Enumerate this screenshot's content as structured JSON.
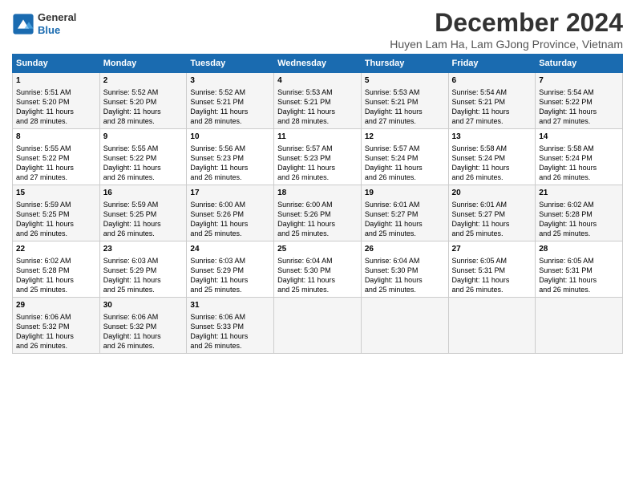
{
  "logo": {
    "general": "General",
    "blue": "Blue"
  },
  "title": "December 2024",
  "subtitle": "Huyen Lam Ha, Lam GJong Province, Vietnam",
  "days_of_week": [
    "Sunday",
    "Monday",
    "Tuesday",
    "Wednesday",
    "Thursday",
    "Friday",
    "Saturday"
  ],
  "weeks": [
    [
      {
        "day": "1",
        "info": "Sunrise: 5:51 AM\nSunset: 5:20 PM\nDaylight: 11 hours\nand 28 minutes."
      },
      {
        "day": "2",
        "info": "Sunrise: 5:52 AM\nSunset: 5:20 PM\nDaylight: 11 hours\nand 28 minutes."
      },
      {
        "day": "3",
        "info": "Sunrise: 5:52 AM\nSunset: 5:21 PM\nDaylight: 11 hours\nand 28 minutes."
      },
      {
        "day": "4",
        "info": "Sunrise: 5:53 AM\nSunset: 5:21 PM\nDaylight: 11 hours\nand 28 minutes."
      },
      {
        "day": "5",
        "info": "Sunrise: 5:53 AM\nSunset: 5:21 PM\nDaylight: 11 hours\nand 27 minutes."
      },
      {
        "day": "6",
        "info": "Sunrise: 5:54 AM\nSunset: 5:21 PM\nDaylight: 11 hours\nand 27 minutes."
      },
      {
        "day": "7",
        "info": "Sunrise: 5:54 AM\nSunset: 5:22 PM\nDaylight: 11 hours\nand 27 minutes."
      }
    ],
    [
      {
        "day": "8",
        "info": "Sunrise: 5:55 AM\nSunset: 5:22 PM\nDaylight: 11 hours\nand 27 minutes."
      },
      {
        "day": "9",
        "info": "Sunrise: 5:55 AM\nSunset: 5:22 PM\nDaylight: 11 hours\nand 26 minutes."
      },
      {
        "day": "10",
        "info": "Sunrise: 5:56 AM\nSunset: 5:23 PM\nDaylight: 11 hours\nand 26 minutes."
      },
      {
        "day": "11",
        "info": "Sunrise: 5:57 AM\nSunset: 5:23 PM\nDaylight: 11 hours\nand 26 minutes."
      },
      {
        "day": "12",
        "info": "Sunrise: 5:57 AM\nSunset: 5:24 PM\nDaylight: 11 hours\nand 26 minutes."
      },
      {
        "day": "13",
        "info": "Sunrise: 5:58 AM\nSunset: 5:24 PM\nDaylight: 11 hours\nand 26 minutes."
      },
      {
        "day": "14",
        "info": "Sunrise: 5:58 AM\nSunset: 5:24 PM\nDaylight: 11 hours\nand 26 minutes."
      }
    ],
    [
      {
        "day": "15",
        "info": "Sunrise: 5:59 AM\nSunset: 5:25 PM\nDaylight: 11 hours\nand 26 minutes."
      },
      {
        "day": "16",
        "info": "Sunrise: 5:59 AM\nSunset: 5:25 PM\nDaylight: 11 hours\nand 26 minutes."
      },
      {
        "day": "17",
        "info": "Sunrise: 6:00 AM\nSunset: 5:26 PM\nDaylight: 11 hours\nand 25 minutes."
      },
      {
        "day": "18",
        "info": "Sunrise: 6:00 AM\nSunset: 5:26 PM\nDaylight: 11 hours\nand 25 minutes."
      },
      {
        "day": "19",
        "info": "Sunrise: 6:01 AM\nSunset: 5:27 PM\nDaylight: 11 hours\nand 25 minutes."
      },
      {
        "day": "20",
        "info": "Sunrise: 6:01 AM\nSunset: 5:27 PM\nDaylight: 11 hours\nand 25 minutes."
      },
      {
        "day": "21",
        "info": "Sunrise: 6:02 AM\nSunset: 5:28 PM\nDaylight: 11 hours\nand 25 minutes."
      }
    ],
    [
      {
        "day": "22",
        "info": "Sunrise: 6:02 AM\nSunset: 5:28 PM\nDaylight: 11 hours\nand 25 minutes."
      },
      {
        "day": "23",
        "info": "Sunrise: 6:03 AM\nSunset: 5:29 PM\nDaylight: 11 hours\nand 25 minutes."
      },
      {
        "day": "24",
        "info": "Sunrise: 6:03 AM\nSunset: 5:29 PM\nDaylight: 11 hours\nand 25 minutes."
      },
      {
        "day": "25",
        "info": "Sunrise: 6:04 AM\nSunset: 5:30 PM\nDaylight: 11 hours\nand 25 minutes."
      },
      {
        "day": "26",
        "info": "Sunrise: 6:04 AM\nSunset: 5:30 PM\nDaylight: 11 hours\nand 25 minutes."
      },
      {
        "day": "27",
        "info": "Sunrise: 6:05 AM\nSunset: 5:31 PM\nDaylight: 11 hours\nand 26 minutes."
      },
      {
        "day": "28",
        "info": "Sunrise: 6:05 AM\nSunset: 5:31 PM\nDaylight: 11 hours\nand 26 minutes."
      }
    ],
    [
      {
        "day": "29",
        "info": "Sunrise: 6:06 AM\nSunset: 5:32 PM\nDaylight: 11 hours\nand 26 minutes."
      },
      {
        "day": "30",
        "info": "Sunrise: 6:06 AM\nSunset: 5:32 PM\nDaylight: 11 hours\nand 26 minutes."
      },
      {
        "day": "31",
        "info": "Sunrise: 6:06 AM\nSunset: 5:33 PM\nDaylight: 11 hours\nand 26 minutes."
      },
      {
        "day": "",
        "info": ""
      },
      {
        "day": "",
        "info": ""
      },
      {
        "day": "",
        "info": ""
      },
      {
        "day": "",
        "info": ""
      }
    ]
  ]
}
